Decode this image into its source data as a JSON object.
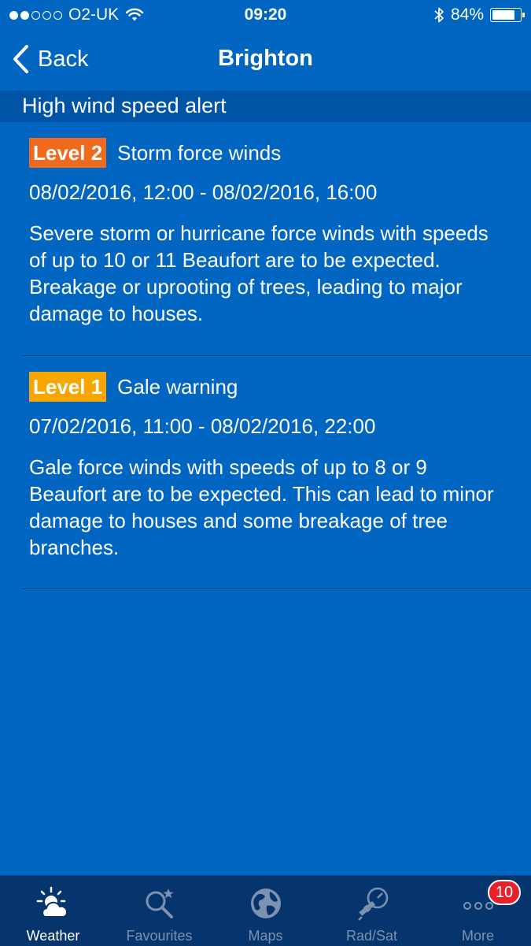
{
  "status_bar": {
    "carrier": "O2-UK",
    "time": "09:20",
    "battery": "84%",
    "battery_level": 0.84,
    "signal_bars_filled": 2,
    "signal_bars_total": 5
  },
  "nav": {
    "back_label": "Back",
    "title": "Brighton"
  },
  "section": {
    "title": "High wind speed alert"
  },
  "alerts": [
    {
      "level": "Level 2",
      "title": "Storm force winds",
      "time_range": "08/02/2016, 12:00 - 08/02/2016, 16:00",
      "description": "Severe storm or hurricane force winds with speeds of up to 10 or 11 Beaufort are to be expected. Breakage or uprooting of trees, leading to major damage to houses.",
      "badge_color": "#f06a1e"
    },
    {
      "level": "Level 1",
      "title": "Gale warning",
      "time_range": "07/02/2016, 11:00 - 08/02/2016, 22:00",
      "description": "Gale force winds with speeds of up to 8 or 9 Beaufort are to be expected. This can lead to minor damage to houses and some breakage of tree branches.",
      "badge_color": "#f7a600"
    }
  ],
  "tab_bar": {
    "tabs": [
      {
        "label": "Weather",
        "icon": "weather-icon",
        "active": true
      },
      {
        "label": "Favourites",
        "icon": "favourites-icon",
        "active": false
      },
      {
        "label": "Maps",
        "icon": "globe-icon",
        "active": false
      },
      {
        "label": "Rad/Sat",
        "icon": "satellite-icon",
        "active": false
      },
      {
        "label": "More",
        "icon": "more-icon",
        "active": false
      }
    ],
    "more_badge": "10"
  },
  "colors": {
    "background": "#0066c2",
    "section_header": "#0054a6",
    "tab_bar": "#06356e",
    "tab_inactive": "#7c92b0",
    "badge_red": "#e8202a"
  }
}
